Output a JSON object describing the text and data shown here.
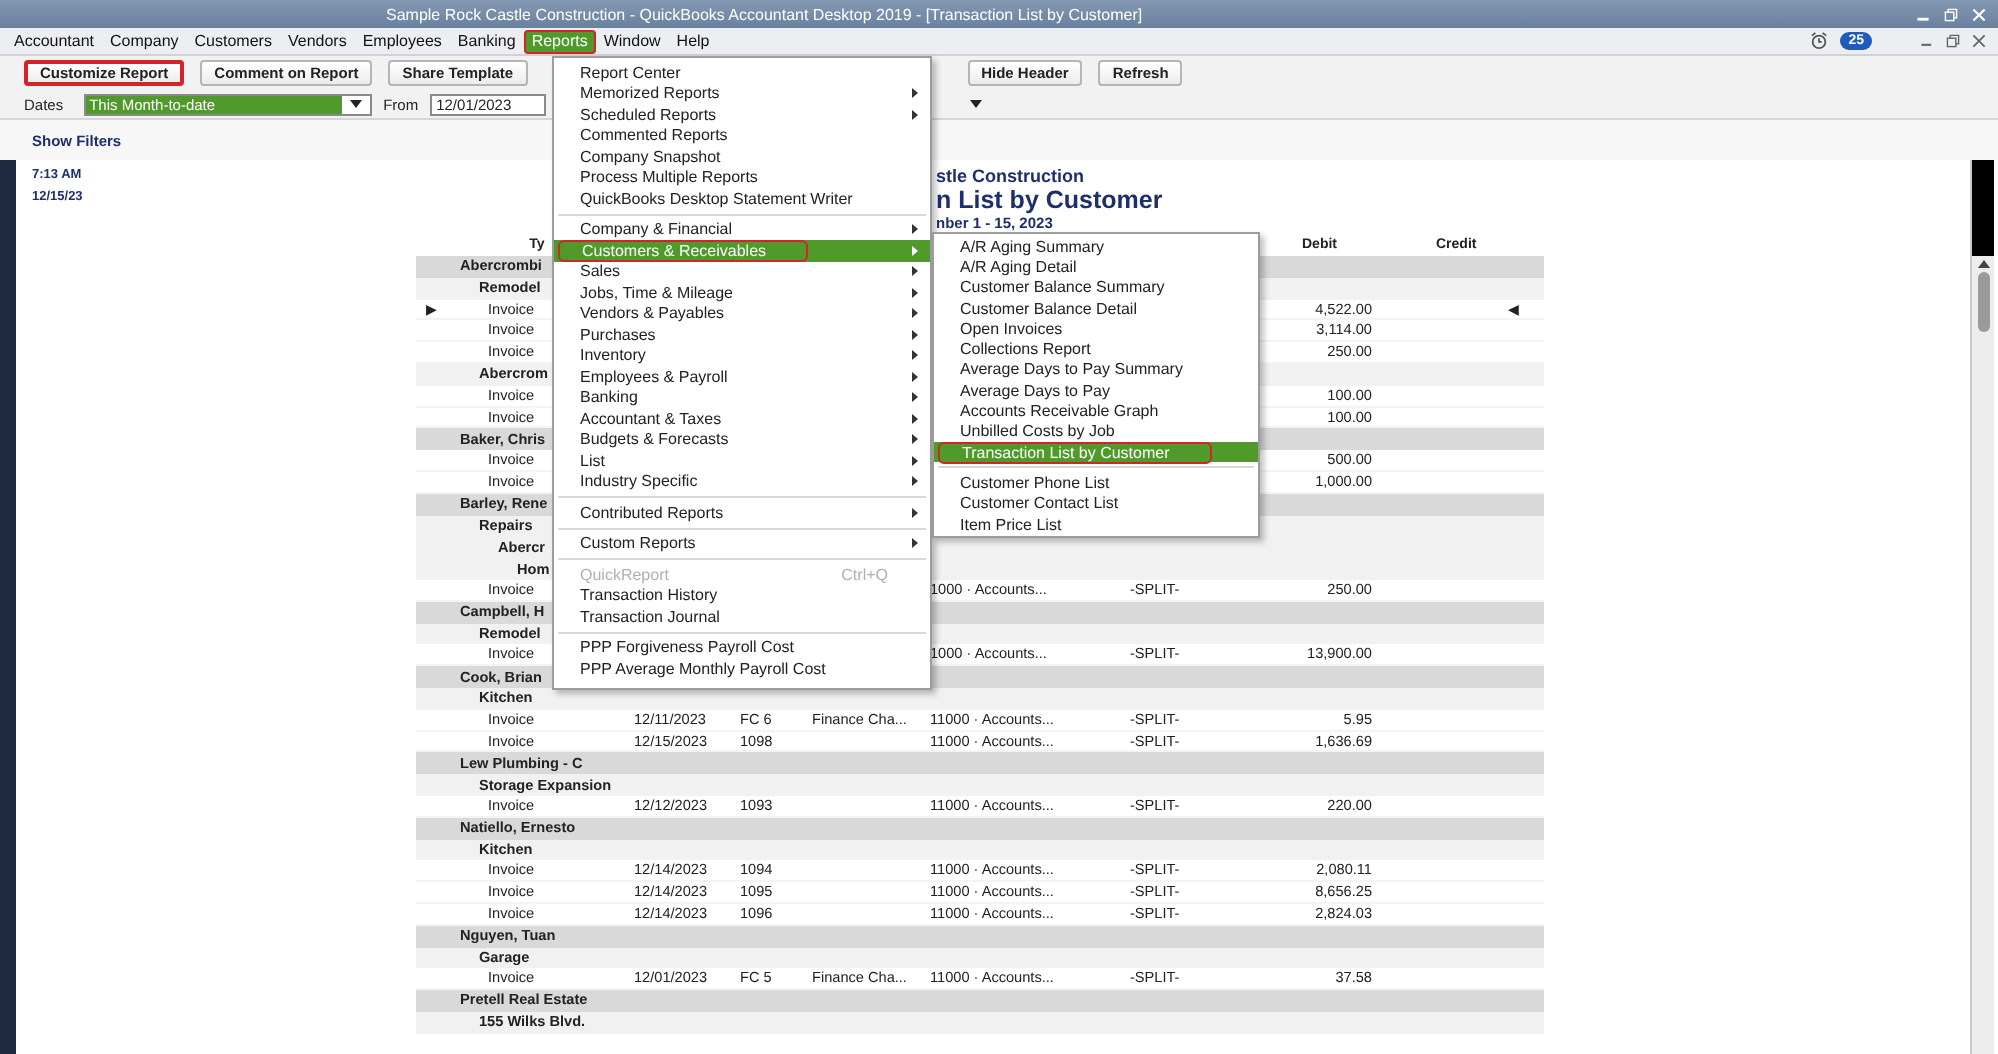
{
  "window": {
    "title": "Sample Rock Castle Construction - QuickBooks Accountant Desktop 2019 - [Transaction List by Customer]"
  },
  "menu_bar": {
    "notification_count": "25",
    "items": [
      {
        "label": "Accountant",
        "selected": false
      },
      {
        "label": "Company",
        "selected": false
      },
      {
        "label": "Customers",
        "selected": false
      },
      {
        "label": "Vendors",
        "selected": false
      },
      {
        "label": "Employees",
        "selected": false
      },
      {
        "label": "Banking",
        "selected": false
      },
      {
        "label": "Reports",
        "selected": true
      },
      {
        "label": "Window",
        "selected": false
      },
      {
        "label": "Help",
        "selected": false
      }
    ]
  },
  "toolbar": {
    "buttons_left": [
      {
        "label": "Customize Report",
        "highlighted": true
      },
      {
        "label": "Comment on Report",
        "highlighted": false
      },
      {
        "label": "Share Template",
        "highlighted": false
      }
    ],
    "buttons_right": [
      {
        "label": "Hide Header",
        "highlighted": false
      },
      {
        "label": "Refresh",
        "highlighted": false
      }
    ]
  },
  "filters": {
    "dates_label": "Dates",
    "dates_value": "This Month-to-date",
    "from_label": "From",
    "from_value": "12/01/2023"
  },
  "show_filters": "Show Filters",
  "report": {
    "time": "7:13 AM",
    "date": "12/15/23",
    "company": "stle Construction",
    "title": "n List by Customer",
    "period": "nber 1 - 15, 2023",
    "header": {
      "type": "Ty",
      "debit": "Debit",
      "credit": "Credit"
    },
    "groups": [
      {
        "name": "Abercrombi",
        "children": [
          {
            "name": "Remodel",
            "rows": [
              {
                "type": "Invoice",
                "debit": "4,522.00",
                "marker_left": "▶",
                "marker_right": "◀"
              },
              {
                "type": "Invoice",
                "debit": "3,114.00"
              },
              {
                "type": "Invoice",
                "debit": "250.00"
              }
            ]
          },
          {
            "name": "Abercrom",
            "rows": [
              {
                "type": "Invoice",
                "debit": "100.00"
              },
              {
                "type": "Invoice",
                "debit": "100.00"
              }
            ]
          }
        ]
      },
      {
        "name": "Baker, Chris",
        "rows": [
          {
            "type": "Invoice",
            "debit": "500.00"
          },
          {
            "type": "Invoice",
            "debit": "1,000.00"
          }
        ]
      },
      {
        "name": "Barley, Rene",
        "children": [
          {
            "name": "Repairs",
            "children": [
              {
                "name": "Abercr",
                "children": [
                  {
                    "name": "Hom",
                    "rows": [
                      {
                        "type": "Invoice",
                        "account": "1000 · Accounts...",
                        "split": "-SPLIT-",
                        "debit": "250.00"
                      }
                    ]
                  }
                ]
              }
            ]
          }
        ]
      },
      {
        "name": "Campbell, H",
        "children": [
          {
            "name": "Remodel",
            "rows": [
              {
                "type": "Invoice",
                "account": "1000 · Accounts...",
                "split": "-SPLIT-",
                "debit": "13,900.00"
              }
            ]
          }
        ]
      },
      {
        "name": "Cook, Brian",
        "children": [
          {
            "name": "Kitchen",
            "rows": [
              {
                "type": "Invoice",
                "date": "12/11/2023",
                "num": "FC 6",
                "memo": "Finance Cha...",
                "account": "11000 · Accounts...",
                "split": "-SPLIT-",
                "debit": "5.95"
              },
              {
                "type": "Invoice",
                "date": "12/15/2023",
                "num": "1098",
                "account": "11000 · Accounts...",
                "split": "-SPLIT-",
                "debit": "1,636.69"
              }
            ]
          }
        ]
      },
      {
        "name": "Lew Plumbing - C",
        "children": [
          {
            "name": "Storage Expansion",
            "rows": [
              {
                "type": "Invoice",
                "date": "12/12/2023",
                "num": "1093",
                "account": "11000 · Accounts...",
                "split": "-SPLIT-",
                "debit": "220.00"
              }
            ]
          }
        ]
      },
      {
        "name": "Natiello, Ernesto",
        "children": [
          {
            "name": "Kitchen",
            "rows": [
              {
                "type": "Invoice",
                "date": "12/14/2023",
                "num": "1094",
                "account": "11000 · Accounts...",
                "split": "-SPLIT-",
                "debit": "2,080.11"
              },
              {
                "type": "Invoice",
                "date": "12/14/2023",
                "num": "1095",
                "account": "11000 · Accounts...",
                "split": "-SPLIT-",
                "debit": "8,656.25"
              },
              {
                "type": "Invoice",
                "date": "12/14/2023",
                "num": "1096",
                "account": "11000 · Accounts...",
                "split": "-SPLIT-",
                "debit": "2,824.03"
              }
            ]
          }
        ]
      },
      {
        "name": "Nguyen, Tuan",
        "children": [
          {
            "name": "Garage",
            "rows": [
              {
                "type": "Invoice",
                "date": "12/01/2023",
                "num": "FC 5",
                "memo": "Finance Cha...",
                "account": "11000 · Accounts...",
                "split": "-SPLIT-",
                "debit": "37.58"
              }
            ]
          }
        ]
      },
      {
        "name": "Pretell Real Estate",
        "children": [
          {
            "name": "155 Wilks Blvd."
          }
        ]
      }
    ]
  },
  "reports_menu": {
    "items": [
      {
        "kind": "item",
        "label": "Report Center",
        "has_submenu": false,
        "selected": false,
        "disabled": false
      },
      {
        "kind": "item",
        "label": "Memorized Reports",
        "has_submenu": true,
        "selected": false,
        "disabled": false
      },
      {
        "kind": "item",
        "label": "Scheduled Reports",
        "has_submenu": true,
        "selected": false,
        "disabled": false
      },
      {
        "kind": "item",
        "label": "Commented Reports",
        "has_submenu": false,
        "selected": false,
        "disabled": false
      },
      {
        "kind": "item",
        "label": "Company Snapshot",
        "has_submenu": false,
        "selected": false,
        "disabled": false
      },
      {
        "kind": "item",
        "label": "Process Multiple Reports",
        "has_submenu": false,
        "selected": false,
        "disabled": false
      },
      {
        "kind": "item",
        "label": "QuickBooks Desktop Statement Writer",
        "has_submenu": false,
        "selected": false,
        "disabled": false
      },
      {
        "kind": "separator"
      },
      {
        "kind": "item",
        "label": "Company & Financial",
        "has_submenu": true,
        "selected": false,
        "disabled": false
      },
      {
        "kind": "item",
        "label": "Customers & Receivables",
        "has_submenu": true,
        "selected": true,
        "disabled": false
      },
      {
        "kind": "item",
        "label": "Sales",
        "has_submenu": true,
        "selected": false,
        "disabled": false
      },
      {
        "kind": "item",
        "label": "Jobs, Time & Mileage",
        "has_submenu": true,
        "selected": false,
        "disabled": false
      },
      {
        "kind": "item",
        "label": "Vendors & Payables",
        "has_submenu": true,
        "selected": false,
        "disabled": false
      },
      {
        "kind": "item",
        "label": "Purchases",
        "has_submenu": true,
        "selected": false,
        "disabled": false
      },
      {
        "kind": "item",
        "label": "Inventory",
        "has_submenu": true,
        "selected": false,
        "disabled": false
      },
      {
        "kind": "item",
        "label": "Employees & Payroll",
        "has_submenu": true,
        "selected": false,
        "disabled": false
      },
      {
        "kind": "item",
        "label": "Banking",
        "has_submenu": true,
        "selected": false,
        "disabled": false
      },
      {
        "kind": "item",
        "label": "Accountant & Taxes",
        "has_submenu": true,
        "selected": false,
        "disabled": false
      },
      {
        "kind": "item",
        "label": "Budgets & Forecasts",
        "has_submenu": true,
        "selected": false,
        "disabled": false
      },
      {
        "kind": "item",
        "label": "List",
        "has_submenu": true,
        "selected": false,
        "disabled": false
      },
      {
        "kind": "item",
        "label": "Industry Specific",
        "has_submenu": true,
        "selected": false,
        "disabled": false
      },
      {
        "kind": "separator"
      },
      {
        "kind": "item",
        "label": "Contributed Reports",
        "has_submenu": true,
        "selected": false,
        "disabled": false
      },
      {
        "kind": "separator"
      },
      {
        "kind": "item",
        "label": "Custom Reports",
        "has_submenu": true,
        "selected": false,
        "disabled": false
      },
      {
        "kind": "separator"
      },
      {
        "kind": "item",
        "label": "QuickReport",
        "shortcut": "Ctrl+Q",
        "has_submenu": false,
        "selected": false,
        "disabled": true
      },
      {
        "kind": "item",
        "label": "Transaction History",
        "has_submenu": false,
        "selected": false,
        "disabled": false
      },
      {
        "kind": "item",
        "label": "Transaction Journal",
        "has_submenu": false,
        "selected": false,
        "disabled": false
      },
      {
        "kind": "separator"
      },
      {
        "kind": "item",
        "label": "PPP Forgiveness Payroll Cost",
        "has_submenu": false,
        "selected": false,
        "disabled": false
      },
      {
        "kind": "item",
        "label": "PPP Average Monthly Payroll Cost",
        "has_submenu": false,
        "selected": false,
        "disabled": false
      }
    ]
  },
  "submenu": {
    "items": [
      {
        "kind": "item",
        "label": "A/R Aging Summary",
        "selected": false
      },
      {
        "kind": "item",
        "label": "A/R Aging Detail",
        "selected": false
      },
      {
        "kind": "item",
        "label": "Customer Balance Summary",
        "selected": false
      },
      {
        "kind": "item",
        "label": "Customer Balance Detail",
        "selected": false
      },
      {
        "kind": "item",
        "label": "Open Invoices",
        "selected": false
      },
      {
        "kind": "item",
        "label": "Collections Report",
        "selected": false
      },
      {
        "kind": "item",
        "label": "Average Days to Pay Summary",
        "selected": false
      },
      {
        "kind": "item",
        "label": "Average Days to Pay",
        "selected": false
      },
      {
        "kind": "item",
        "label": "Accounts Receivable Graph",
        "selected": false
      },
      {
        "kind": "item",
        "label": "Unbilled Costs by Job",
        "selected": false
      },
      {
        "kind": "item",
        "label": "Transaction List by Customer",
        "selected": true
      },
      {
        "kind": "separator"
      },
      {
        "kind": "item",
        "label": "Customer Phone List",
        "selected": false
      },
      {
        "kind": "item",
        "label": "Customer Contact List",
        "selected": false
      },
      {
        "kind": "item",
        "label": "Item Price List",
        "selected": false
      }
    ]
  }
}
